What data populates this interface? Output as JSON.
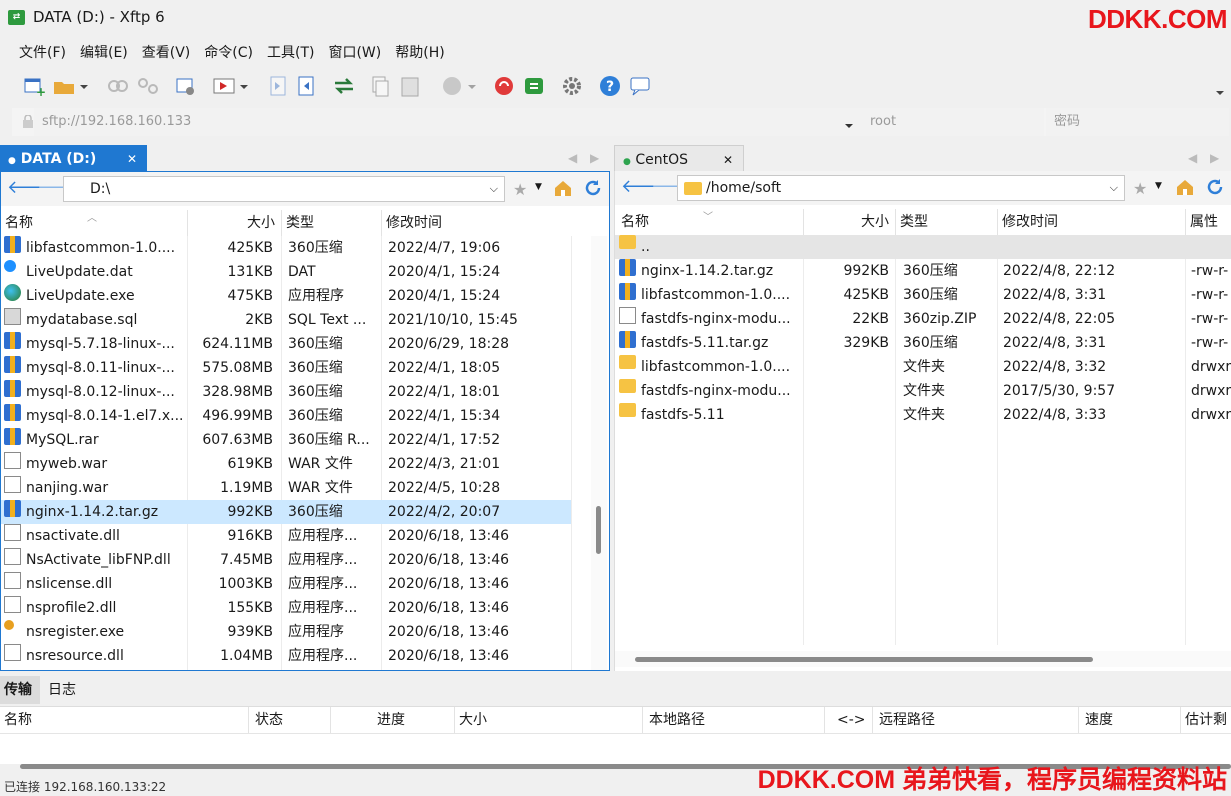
{
  "window": {
    "title": "DATA (D:)  - Xftp 6",
    "icon": "xftp-app-icon"
  },
  "watermark_top": "DDKK.COM",
  "watermark_bottom": "DDKK.COM 弟弟快看，程序员编程资料站",
  "menu": [
    "文件(F)",
    "编辑(E)",
    "查看(V)",
    "命令(C)",
    "工具(T)",
    "窗口(W)",
    "帮助(H)"
  ],
  "toolbar": [
    "new-session-icon",
    "open-folder-icon",
    "connect-icon",
    "disconnect-icon",
    "properties-icon",
    "transfer-icon",
    "upload-icon",
    "download-icon",
    "sync-icon",
    "copy-icon",
    "paste-icon",
    "record-icon",
    "xshell-icon",
    "xftp-icon",
    "settings-icon",
    "help-icon",
    "chat-icon"
  ],
  "address": {
    "host": "sftp://192.168.160.133",
    "user": "root",
    "password_placeholder": "密码"
  },
  "left": {
    "tab": "DATA (D:)",
    "path": "D:\\",
    "headers": [
      "名称",
      "大小",
      "类型",
      "修改时间"
    ],
    "files": [
      {
        "name": "libfastcommon-1.0....",
        "size": "425KB",
        "type": "360压缩",
        "time": "2022/4/7, 19:06",
        "icon": "zip"
      },
      {
        "name": "LiveUpdate.dat",
        "size": "131KB",
        "type": "DAT",
        "time": "2020/4/1, 15:24",
        "icon": "dat"
      },
      {
        "name": "LiveUpdate.exe",
        "size": "475KB",
        "type": "应用程序",
        "time": "2020/4/1, 15:24",
        "icon": "exe"
      },
      {
        "name": "mydatabase.sql",
        "size": "2KB",
        "type": "SQL Text ...",
        "time": "2021/10/10, 15:45",
        "icon": "sql"
      },
      {
        "name": "mysql-5.7.18-linux-...",
        "size": "624.11MB",
        "type": "360压缩",
        "time": "2020/6/29, 18:28",
        "icon": "zip"
      },
      {
        "name": "mysql-8.0.11-linux-...",
        "size": "575.08MB",
        "type": "360压缩",
        "time": "2022/4/1, 18:05",
        "icon": "zip"
      },
      {
        "name": "mysql-8.0.12-linux-...",
        "size": "328.98MB",
        "type": "360压缩",
        "time": "2022/4/1, 18:01",
        "icon": "zip"
      },
      {
        "name": "mysql-8.0.14-1.el7.x...",
        "size": "496.99MB",
        "type": "360压缩",
        "time": "2022/4/1, 15:34",
        "icon": "zip"
      },
      {
        "name": "MySQL.rar",
        "size": "607.63MB",
        "type": "360压缩 R...",
        "time": "2022/4/1, 17:52",
        "icon": "zip"
      },
      {
        "name": "myweb.war",
        "size": "619KB",
        "type": "WAR 文件",
        "time": "2022/4/3, 21:01",
        "icon": "doc"
      },
      {
        "name": "nanjing.war",
        "size": "1.19MB",
        "type": "WAR 文件",
        "time": "2022/4/5, 10:28",
        "icon": "doc"
      },
      {
        "name": "nginx-1.14.2.tar.gz",
        "size": "992KB",
        "type": "360压缩",
        "time": "2022/4/2, 20:07",
        "icon": "zip",
        "selected": true
      },
      {
        "name": "nsactivate.dll",
        "size": "916KB",
        "type": "应用程序...",
        "time": "2020/6/18, 13:46",
        "icon": "dll"
      },
      {
        "name": "NsActivate_libFNP.dll",
        "size": "7.45MB",
        "type": "应用程序...",
        "time": "2020/6/18, 13:46",
        "icon": "dll"
      },
      {
        "name": "nslicense.dll",
        "size": "1003KB",
        "type": "应用程序...",
        "time": "2020/6/18, 13:46",
        "icon": "dll"
      },
      {
        "name": "nsprofile2.dll",
        "size": "155KB",
        "type": "应用程序...",
        "time": "2020/6/18, 13:46",
        "icon": "dll"
      },
      {
        "name": "nsregister.exe",
        "size": "939KB",
        "type": "应用程序",
        "time": "2020/6/18, 13:46",
        "icon": "key"
      },
      {
        "name": "nsresource.dll",
        "size": "1.04MB",
        "type": "应用程序...",
        "time": "2020/6/18, 13:46",
        "icon": "dll"
      }
    ]
  },
  "right": {
    "tab": "CentOS",
    "path": "/home/soft",
    "headers": [
      "名称",
      "大小",
      "类型",
      "修改时间",
      "属性"
    ],
    "files": [
      {
        "name": "..",
        "size": "",
        "type": "",
        "time": "",
        "attr": "",
        "icon": "fold",
        "parent": true
      },
      {
        "name": "nginx-1.14.2.tar.gz",
        "size": "992KB",
        "type": "360压缩",
        "time": "2022/4/8, 22:12",
        "attr": "-rw-r-",
        "icon": "zip"
      },
      {
        "name": "libfastcommon-1.0....",
        "size": "425KB",
        "type": "360压缩",
        "time": "2022/4/8, 3:31",
        "attr": "-rw-r-",
        "icon": "zip"
      },
      {
        "name": "fastdfs-nginx-modu...",
        "size": "22KB",
        "type": "360zip.ZIP",
        "time": "2022/4/8, 22:05",
        "attr": "-rw-r-",
        "icon": "doc"
      },
      {
        "name": "fastdfs-5.11.tar.gz",
        "size": "329KB",
        "type": "360压缩",
        "time": "2022/4/8, 3:31",
        "attr": "-rw-r-",
        "icon": "zip"
      },
      {
        "name": "libfastcommon-1.0....",
        "size": "",
        "type": "文件夹",
        "time": "2022/4/8, 3:32",
        "attr": "drwxr",
        "icon": "fold"
      },
      {
        "name": "fastdfs-nginx-modu...",
        "size": "",
        "type": "文件夹",
        "time": "2017/5/30, 9:57",
        "attr": "drwxr",
        "icon": "fold"
      },
      {
        "name": "fastdfs-5.11",
        "size": "",
        "type": "文件夹",
        "time": "2022/4/8, 3:33",
        "attr": "drwxr",
        "icon": "fold"
      }
    ]
  },
  "bottom": {
    "tabs": [
      "传输",
      "日志"
    ],
    "headers": [
      "名称",
      "状态",
      "进度",
      "大小",
      "本地路径",
      "<->",
      "远程路径",
      "速度",
      "估计剩"
    ]
  },
  "status": "已连接 192.168.160.133:22"
}
